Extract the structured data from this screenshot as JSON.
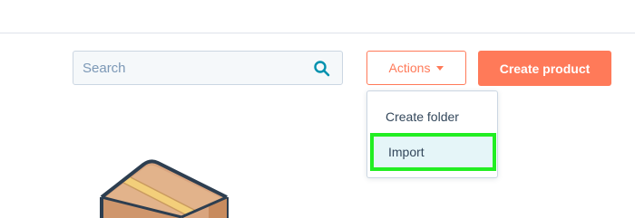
{
  "search": {
    "placeholder": "Search",
    "value": "",
    "icon": "search-icon"
  },
  "toolbar": {
    "actions_label": "Actions",
    "create_label": "Create product"
  },
  "actions_menu": {
    "items": [
      {
        "label": "Create folder"
      },
      {
        "label": "Import",
        "highlighted": true
      }
    ]
  },
  "colors": {
    "accent": "#ff7a59",
    "search_icon": "#0091ae",
    "highlight_border": "#22ee22",
    "highlight_bg": "#e5f5f8"
  }
}
